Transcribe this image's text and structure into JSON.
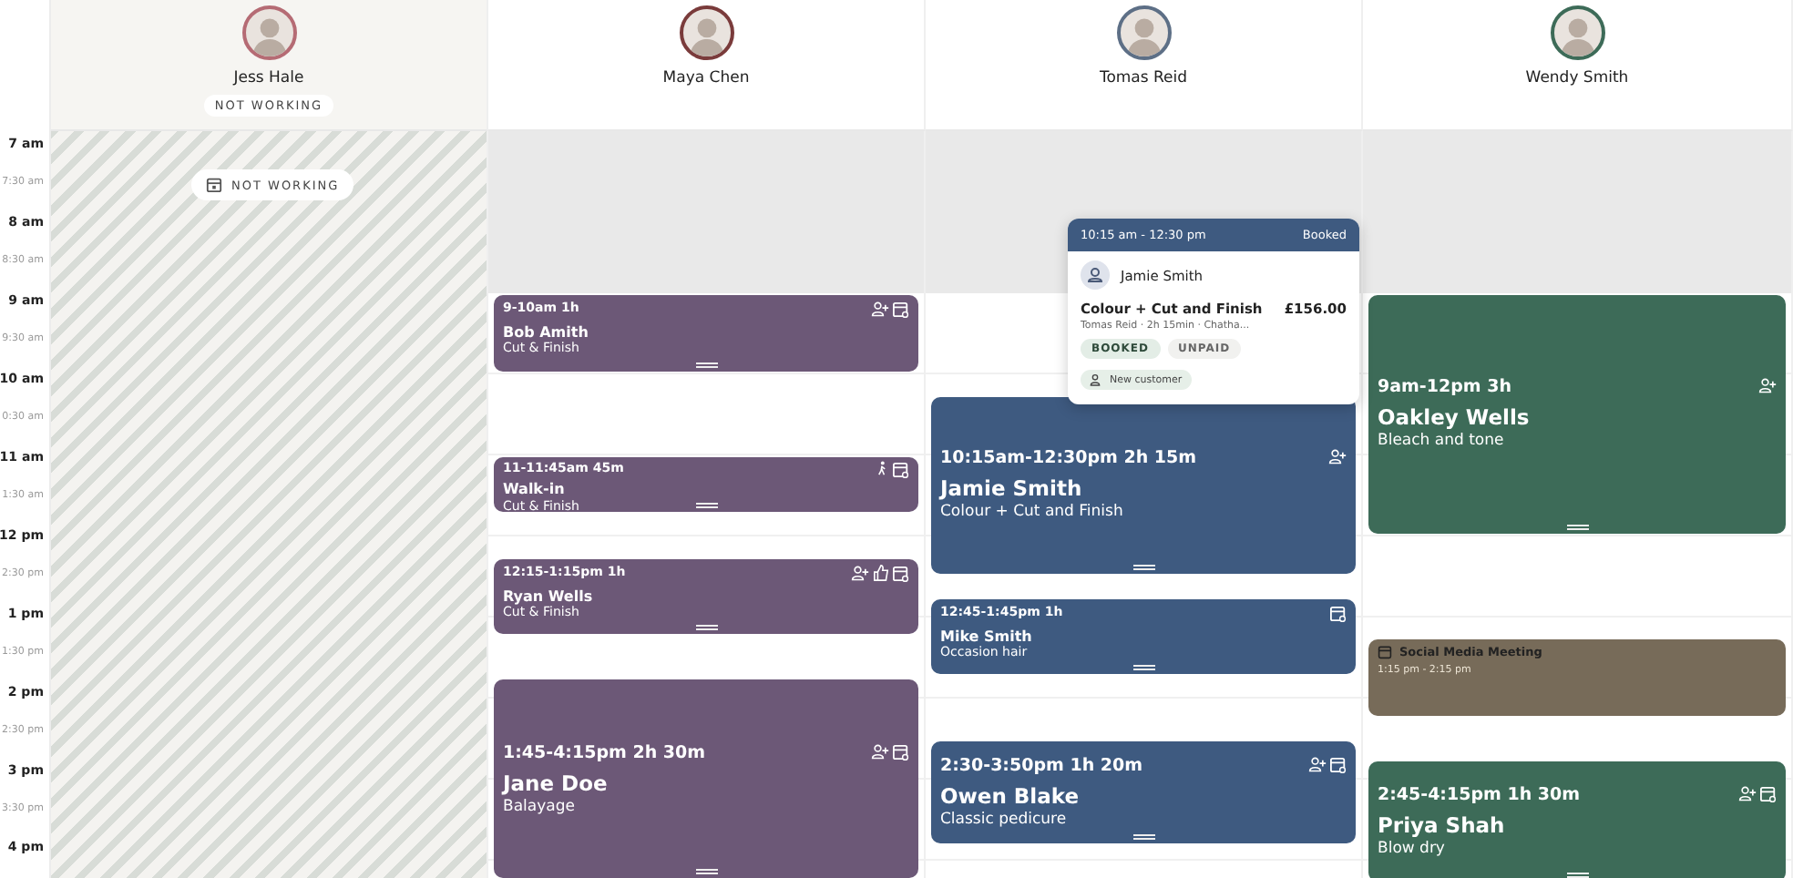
{
  "time_labels": [
    {
      "label": "7 am",
      "kind": "hour"
    },
    {
      "label": "7:30 am",
      "kind": "half"
    },
    {
      "label": "8 am",
      "kind": "hour"
    },
    {
      "label": "8:30 am",
      "kind": "half"
    },
    {
      "label": "9 am",
      "kind": "hour"
    },
    {
      "label": "9:30 am",
      "kind": "half"
    },
    {
      "label": "10 am",
      "kind": "hour"
    },
    {
      "label": "0:30 am",
      "kind": "half"
    },
    {
      "label": "11 am",
      "kind": "hour"
    },
    {
      "label": "1:30 am",
      "kind": "half"
    },
    {
      "label": "12 pm",
      "kind": "hour"
    },
    {
      "label": "2:30 pm",
      "kind": "half"
    },
    {
      "label": "1 pm",
      "kind": "hour"
    },
    {
      "label": "1:30 pm",
      "kind": "half"
    },
    {
      "label": "2 pm",
      "kind": "hour"
    },
    {
      "label": "2:30 pm",
      "kind": "half"
    },
    {
      "label": "3 pm",
      "kind": "hour"
    },
    {
      "label": "3:30 pm",
      "kind": "half"
    },
    {
      "label": "4 pm",
      "kind": "hour"
    }
  ],
  "staff": [
    {
      "name": "Jess Hale",
      "color": "#b56b74",
      "working": false,
      "badge": "NOT WORKING",
      "off_label": "NOT WORKING"
    },
    {
      "name": "Maya Chen",
      "color": "#7a3b3b",
      "working": true,
      "events": [
        {
          "kind": "appointment",
          "color": "#6c5877",
          "time": "9-10am 1h",
          "name": "Bob Amith",
          "service": "Cut & Finish"
        },
        {
          "kind": "appointment",
          "color": "#6c5877",
          "time": "11-11:45am 45m",
          "name": "Walk-in",
          "service": "Cut & Finish"
        },
        {
          "kind": "appointment",
          "color": "#6c5877",
          "time": "12:15-1:15pm 1h",
          "name": "Ryan Wells",
          "service": "Cut & Finish"
        },
        {
          "kind": "appointment",
          "color": "#6c5877",
          "time": "1:45-4:15pm 2h 30m",
          "name": "Jane Doe",
          "service": "Balayage"
        }
      ]
    },
    {
      "name": "Tomas Reid",
      "color": "#5d6f86",
      "working": true,
      "events": [
        {
          "kind": "appointment",
          "color": "#3e5a80",
          "time": "10:15am-12:30pm 2h 15m",
          "name": "Jamie Smith",
          "service": "Colour + Cut and Finish"
        },
        {
          "kind": "appointment",
          "color": "#3e5a80",
          "time": "12:45-1:45pm 1h",
          "name": "Mike Smith",
          "service": "Occasion hair"
        },
        {
          "kind": "appointment",
          "color": "#3e5a80",
          "time": "2:30-3:50pm 1h 20m",
          "name": "Owen Blake",
          "service": "Classic pedicure"
        }
      ]
    },
    {
      "name": "Wendy Smith",
      "color": "#3d6b58",
      "working": true,
      "events": [
        {
          "kind": "appointment",
          "color": "#3d6b58",
          "time": "9am-12pm 3h",
          "name": "Oakley Wells",
          "service": "Bleach and tone"
        },
        {
          "kind": "blocked",
          "color": "#776b59",
          "name": "Social Media Meeting",
          "time": "1:15 pm - 2:15 pm"
        },
        {
          "kind": "appointment",
          "color": "#3d6b58",
          "time": "2:45-4:15pm 1h 30m",
          "name": "Priya Shah",
          "service": "Blow dry"
        }
      ]
    }
  ],
  "popover": {
    "time": "10:15 am - 12:30 pm",
    "status": "Booked",
    "client": "Jamie Smith",
    "service": "Colour + Cut and Finish",
    "price": "£156.00",
    "details": "Tomas Reid · 2h 15min · Chatha...",
    "tags": [
      "BOOKED",
      "UNPAID"
    ],
    "note": "New customer"
  }
}
